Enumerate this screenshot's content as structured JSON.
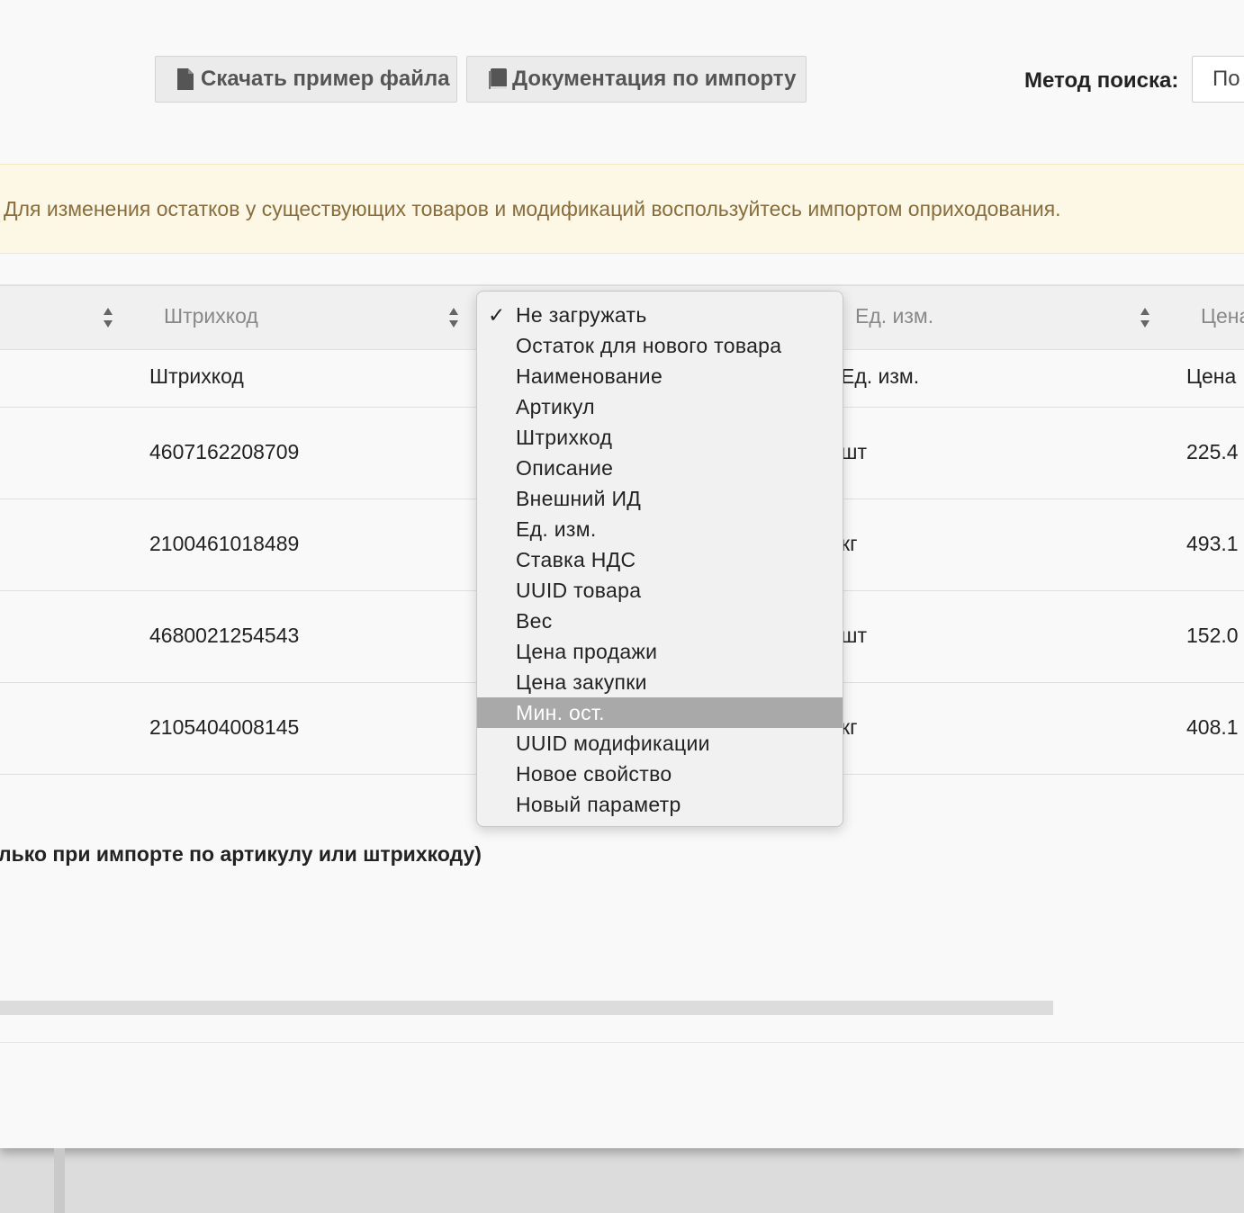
{
  "toolbar": {
    "download_label": "Скачать пример файла",
    "docs_label": "Документация по импорту",
    "search_method_label": "Метод поиска:",
    "search_method_value": "По"
  },
  "alert": {
    "text": "Для изменения остатков у существующих товаров и модификаций воспользуйтесь импортом оприходования."
  },
  "column_selects": {
    "col2": "Штрихкод",
    "col3": "Ед. изм.",
    "col4": "Цена"
  },
  "table": {
    "header": {
      "barcode": "Штрихкод",
      "unit": "Ед. изм.",
      "price": "Цена"
    },
    "rows": [
      {
        "barcode": "4607162208709",
        "unit": "шт",
        "price": "225.4"
      },
      {
        "barcode": "2100461018489",
        "unit": "кг",
        "price": "493.1"
      },
      {
        "barcode": "4680021254543",
        "unit": "шт",
        "price": "152.0"
      },
      {
        "barcode": "2105404008145",
        "unit": "кг",
        "price": "408.1"
      }
    ]
  },
  "note": "лько при импорте по артикулу или штрихкоду)",
  "dropdown": {
    "checkmark": "✓",
    "options": [
      "Не загружать",
      "Остаток для нового товара",
      "Наименование",
      "Артикул",
      "Штрихкод",
      "Описание",
      "Внешний ИД",
      "Ед. изм.",
      "Ставка НДС",
      "UUID товара",
      "Вес",
      "Цена продажи",
      "Цена закупки",
      "Мин. ост.",
      "UUID модификации",
      "Новое свойство",
      "Новый параметр"
    ],
    "selected": "Не загружать",
    "highlighted": "Мин. ост."
  }
}
